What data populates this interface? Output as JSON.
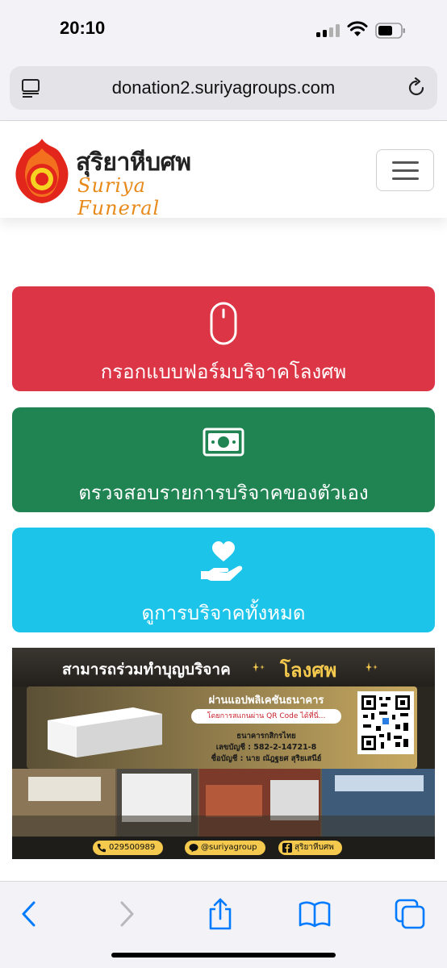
{
  "status_bar": {
    "time": "20:10"
  },
  "browser": {
    "url": "donation2.suriyagroups.com"
  },
  "site": {
    "logo_thai": "สุริยาหีบศพ",
    "logo_en": "Suriya Funeral"
  },
  "actions": [
    {
      "label": "กรอกแบบฟอร์มบริจาคโลงศพ",
      "icon": "mouse-icon",
      "color": "#dc3545"
    },
    {
      "label": "ตรวจสอบรายการบริจาคของตัวเอง",
      "icon": "money-bill-icon",
      "color": "#1f8451"
    },
    {
      "label": "ดูการบริจาคทั้งหมด",
      "icon": "hand-holding-heart-icon",
      "color": "#1cc4ea"
    }
  ],
  "banner": {
    "title": "สามารถร่วมทำบุญบริจาค",
    "title_accent": "โลงศพ",
    "bank_heading": "ผ่านแอปพลิเคชันธนาคาร",
    "scan_note": "โดยการสแกนผ่าน QR Code ได้ที่นี่...",
    "bank_name": "ธนาคารกสิกรไทย",
    "account_no": "เลขบัญชี : 582-2-14721-8",
    "account_name": "ชื่อบัญชี : นาย ณัฎฐยศ สุริยเสนีย์",
    "phone": "029500989",
    "line_id": "@suriyagroup",
    "facebook": "สุริยาหีบศพ"
  },
  "colors": {
    "accent_gold": "#f4c94e",
    "ios_blue": "#007aff"
  }
}
